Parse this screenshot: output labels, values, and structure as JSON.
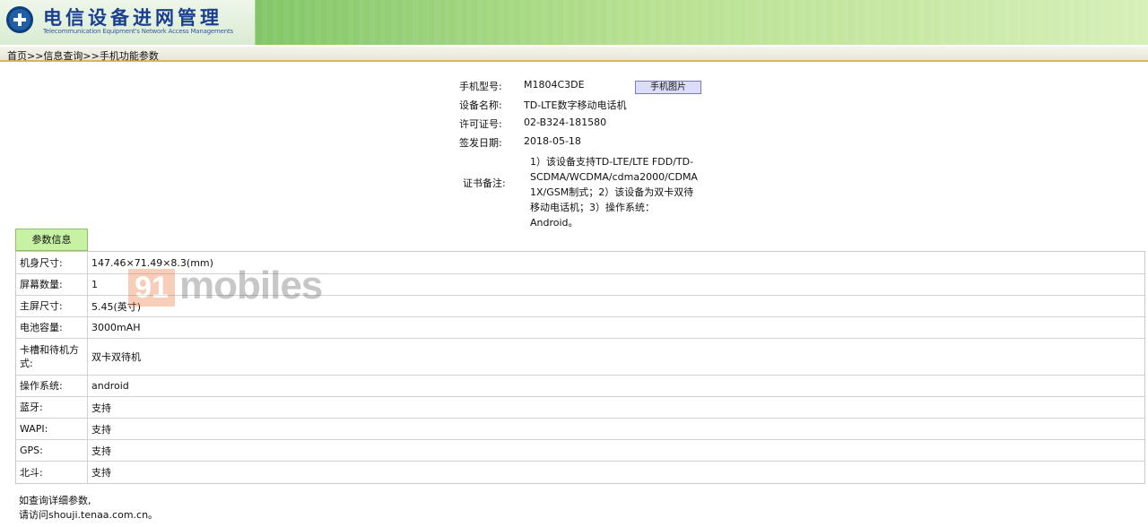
{
  "header": {
    "title": "电信设备进网管理",
    "subtitle": "Telecommunication Equipment's Network Access Managements"
  },
  "breadcrumb": "首页>>信息查询>>手机功能参数",
  "device": {
    "model_label": "手机型号:",
    "model_value": "M1804C3DE",
    "photo_button": "手机图片",
    "name_label": "设备名称:",
    "name_value": "TD-LTE数字移动电话机",
    "license_label": "许可证号:",
    "license_value": "02-B324-181580",
    "date_label": "签发日期:",
    "date_value": "2018-05-18",
    "remark_label": "证书备注:",
    "remark_value": "1）该设备支持TD-LTE/LTE FDD/TD-SCDMA/WCDMA/cdma2000/CDMA 1X/GSM制式；2）该设备为双卡双待移动电话机；3）操作系统：Android。"
  },
  "params": {
    "tab_label": "参数信息",
    "rows": [
      {
        "key": "机身尺寸:",
        "value": "147.46×71.49×8.3(mm)"
      },
      {
        "key": "屏幕数量:",
        "value": "1"
      },
      {
        "key": "主屏尺寸:",
        "value": "5.45(英寸)"
      },
      {
        "key": "电池容量:",
        "value": "3000mAH"
      },
      {
        "key": "卡槽和待机方式:",
        "value": "双卡双待机"
      },
      {
        "key": "操作系统:",
        "value": "android"
      },
      {
        "key": "蓝牙:",
        "value": "支持"
      },
      {
        "key": "WAPI:",
        "value": "支持"
      },
      {
        "key": "GPS:",
        "value": "支持"
      },
      {
        "key": "北斗:",
        "value": "支持"
      }
    ]
  },
  "watermark": {
    "num": "91",
    "text": "mobiles"
  },
  "footer": {
    "line1": "如查询详细参数,",
    "line2": "请访问shouji.tenaa.com.cn。"
  }
}
